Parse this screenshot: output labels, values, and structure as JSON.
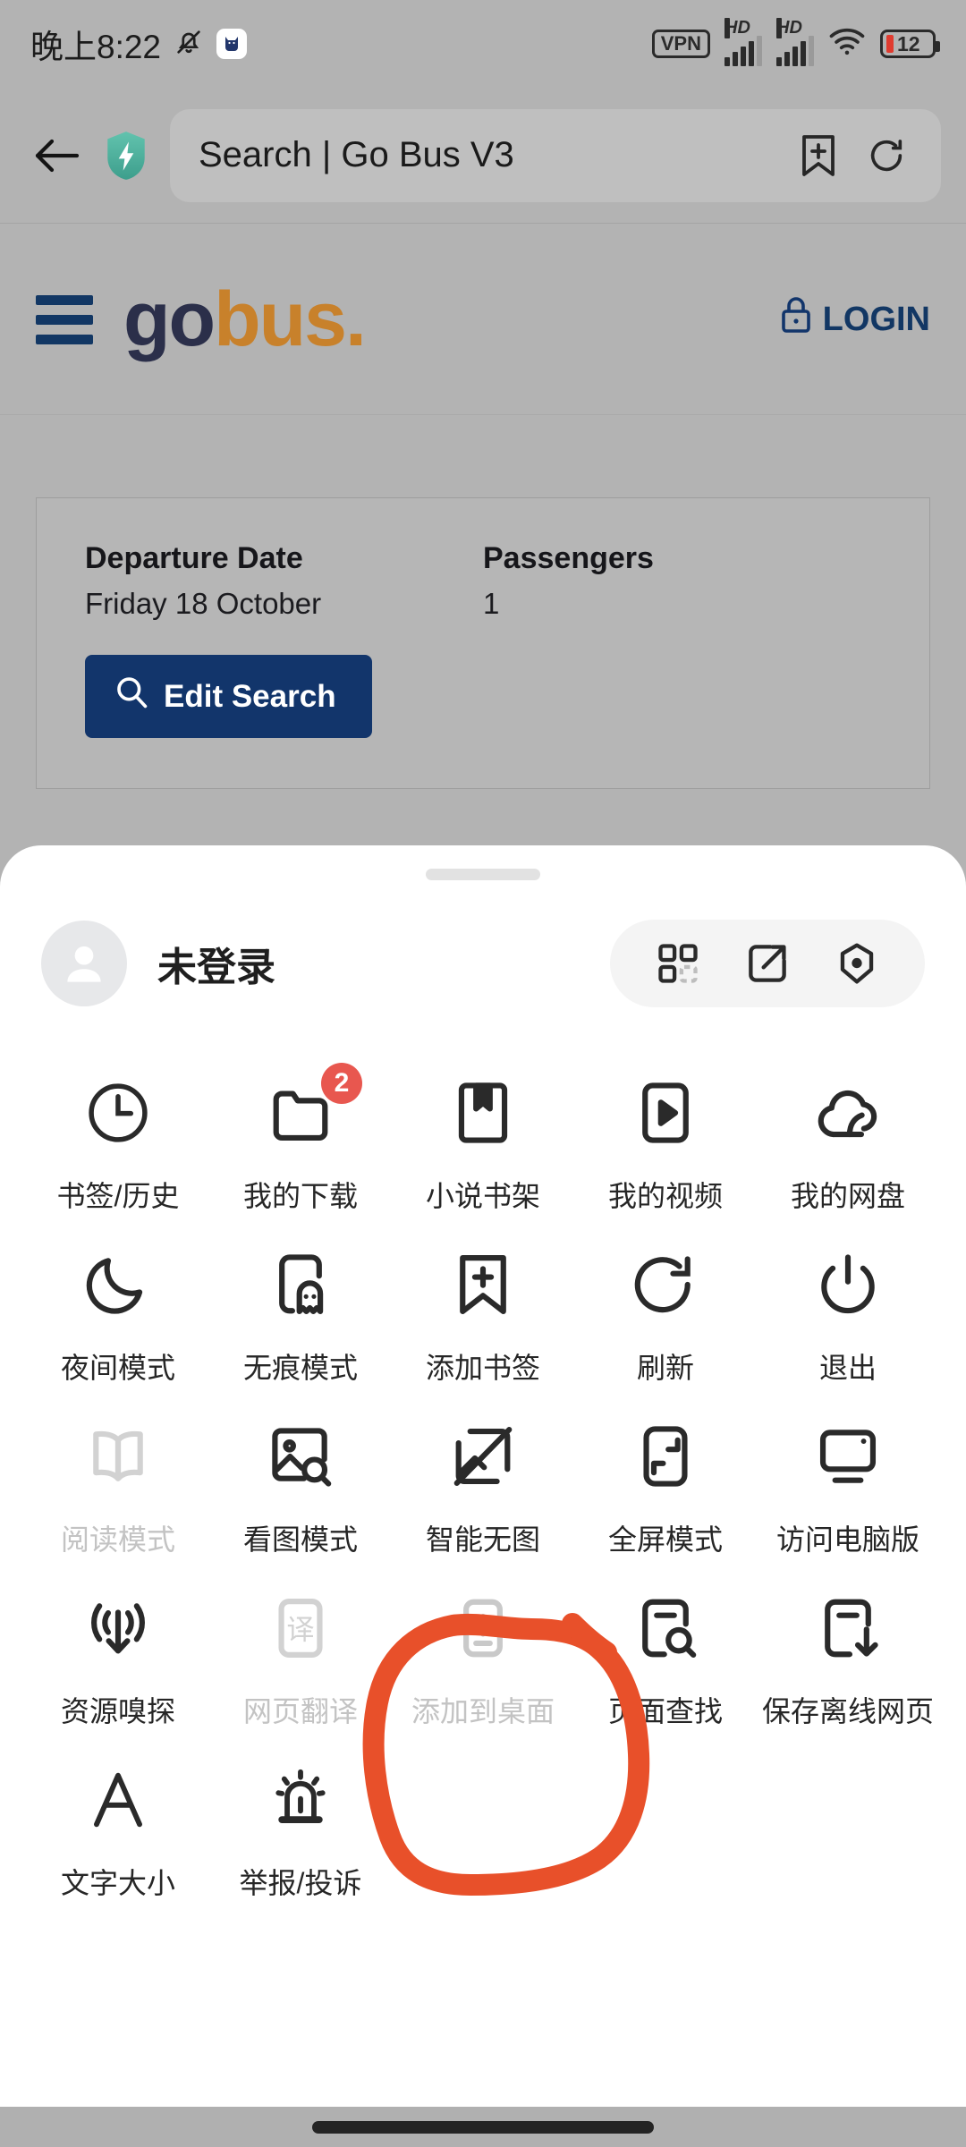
{
  "status_bar": {
    "time": "晚上8:22",
    "mute_icon": "bell-muted-icon",
    "app_icon": "cat-app-icon",
    "vpn_label": "VPN",
    "network_1_label": "HD",
    "network_2_label": "HD",
    "wifi_icon": "wifi-icon",
    "battery_level": "12"
  },
  "toolbar": {
    "back_icon": "back-arrow-icon",
    "shield_icon": "shield-lightning-icon",
    "url_text": "Search | Go Bus V3",
    "bookmark_icon": "add-bookmark-icon",
    "refresh_icon": "refresh-icon"
  },
  "site": {
    "menu_icon": "hamburger-menu-icon",
    "logo_go": "go",
    "logo_bus": "bus.",
    "login_icon": "lock-icon",
    "login_label": "LOGIN",
    "colors": {
      "navy": "#12356b",
      "gold": "#c8812b",
      "accent_red": "#e8502a"
    }
  },
  "search_card": {
    "departure_label": "Departure Date",
    "departure_value": "Friday 18 October",
    "passengers_label": "Passengers",
    "passengers_value": "1",
    "edit_icon": "search-icon",
    "edit_label": "Edit Search"
  },
  "sheet": {
    "account": {
      "avatar_icon": "person-avatar-icon",
      "name": "未登录"
    },
    "quick_actions": [
      {
        "icon": "qr-scan-icon"
      },
      {
        "icon": "share-external-icon"
      },
      {
        "icon": "settings-gear-icon"
      }
    ],
    "rows": [
      [
        {
          "icon": "clock-history-icon",
          "label": "书签/历史",
          "badge": null,
          "disabled": false
        },
        {
          "icon": "folder-download-icon",
          "label": "我的下载",
          "badge": "2",
          "disabled": false
        },
        {
          "icon": "bookshelf-bookmark-icon",
          "label": "小说书架",
          "badge": null,
          "disabled": false
        },
        {
          "icon": "video-play-icon",
          "label": "我的视频",
          "badge": null,
          "disabled": false
        },
        {
          "icon": "cloud-drive-icon",
          "label": "我的网盘",
          "badge": null,
          "disabled": false
        }
      ],
      [
        {
          "icon": "moon-night-icon",
          "label": "夜间模式",
          "badge": null,
          "disabled": false
        },
        {
          "icon": "ghost-incognito-icon",
          "label": "无痕模式",
          "badge": null,
          "disabled": false
        },
        {
          "icon": "bookmark-add-icon",
          "label": "添加书签",
          "badge": null,
          "disabled": false
        },
        {
          "icon": "refresh-circle-icon",
          "label": "刷新",
          "badge": null,
          "disabled": false
        },
        {
          "icon": "power-exit-icon",
          "label": "退出",
          "badge": null,
          "disabled": false
        }
      ],
      [
        {
          "icon": "book-reading-icon",
          "label": "阅读模式",
          "badge": null,
          "disabled": true
        },
        {
          "icon": "image-view-icon",
          "label": "看图模式",
          "badge": null,
          "disabled": false
        },
        {
          "icon": "image-off-icon",
          "label": "智能无图",
          "badge": null,
          "disabled": false
        },
        {
          "icon": "fullscreen-icon",
          "label": "全屏模式",
          "badge": null,
          "disabled": false
        },
        {
          "icon": "desktop-site-icon",
          "label": "访问电脑版",
          "badge": null,
          "disabled": false
        }
      ],
      [
        {
          "icon": "resource-sniffer-icon",
          "label": "资源嗅探",
          "badge": null,
          "disabled": false
        },
        {
          "icon": "translate-icon",
          "label": "网页翻译",
          "badge": null,
          "disabled": true
        },
        {
          "icon": "add-to-desktop-icon",
          "label": "添加到桌面",
          "badge": null,
          "disabled": true
        },
        {
          "icon": "page-find-icon",
          "label": "页面查找",
          "badge": null,
          "disabled": false
        },
        {
          "icon": "save-offline-icon",
          "label": "保存离线网页",
          "badge": null,
          "disabled": false
        }
      ],
      [
        {
          "icon": "font-size-icon",
          "label": "文字大小",
          "badge": null,
          "disabled": false
        },
        {
          "icon": "report-alarm-icon",
          "label": "举报/投诉",
          "badge": null,
          "disabled": false
        }
      ]
    ]
  },
  "annotation": {
    "shape": "hand-drawn-circle",
    "color": "#e8502a",
    "targets": "添加到桌面"
  },
  "nav_bar": {
    "home_indicator": "home-indicator"
  }
}
